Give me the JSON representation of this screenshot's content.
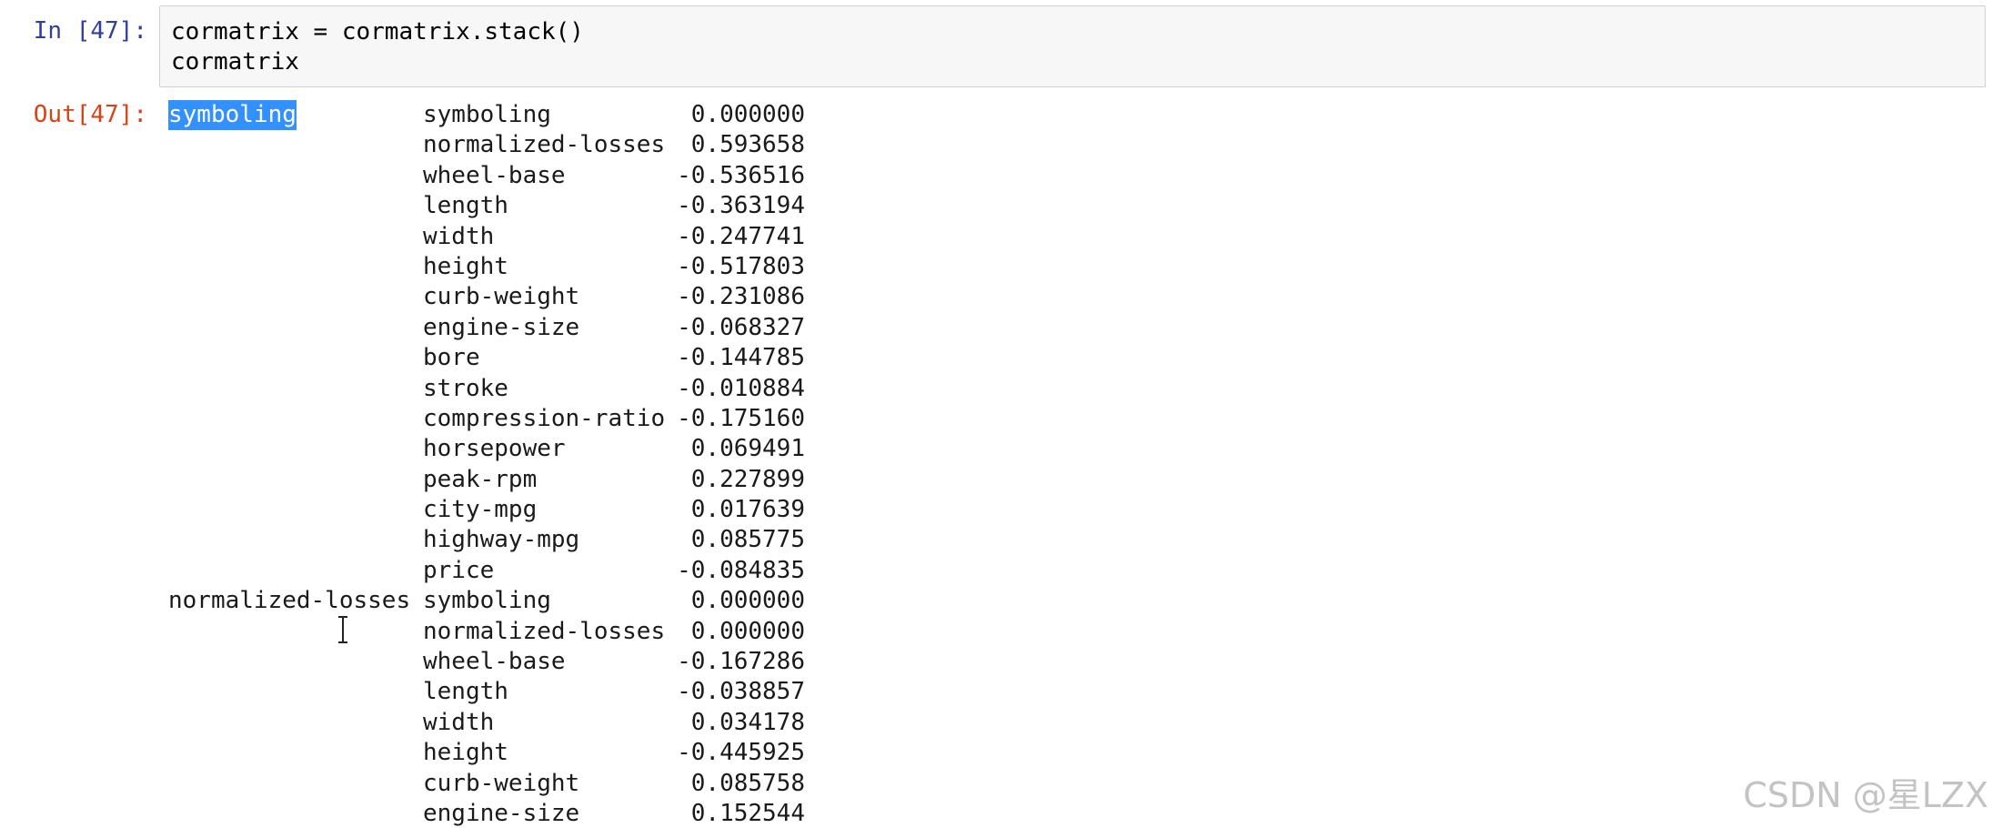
{
  "input_cell": {
    "prompt": "In [47]:",
    "code_lines": [
      "cormatrix = cormatrix.stack()",
      "cormatrix"
    ]
  },
  "output_cell": {
    "prompt": "Out[47]:",
    "rows": [
      {
        "level0": "symboling",
        "level1": "symboling",
        "value": "0.000000"
      },
      {
        "level0": "",
        "level1": "normalized-losses",
        "value": "0.593658"
      },
      {
        "level0": "",
        "level1": "wheel-base",
        "value": "-0.536516"
      },
      {
        "level0": "",
        "level1": "length",
        "value": "-0.363194"
      },
      {
        "level0": "",
        "level1": "width",
        "value": "-0.247741"
      },
      {
        "level0": "",
        "level1": "height",
        "value": "-0.517803"
      },
      {
        "level0": "",
        "level1": "curb-weight",
        "value": "-0.231086"
      },
      {
        "level0": "",
        "level1": "engine-size",
        "value": "-0.068327"
      },
      {
        "level0": "",
        "level1": "bore",
        "value": "-0.144785"
      },
      {
        "level0": "",
        "level1": "stroke",
        "value": "-0.010884"
      },
      {
        "level0": "",
        "level1": "compression-ratio",
        "value": "-0.175160"
      },
      {
        "level0": "",
        "level1": "horsepower",
        "value": "0.069491"
      },
      {
        "level0": "",
        "level1": "peak-rpm",
        "value": "0.227899"
      },
      {
        "level0": "",
        "level1": "city-mpg",
        "value": "0.017639"
      },
      {
        "level0": "",
        "level1": "highway-mpg",
        "value": "0.085775"
      },
      {
        "level0": "",
        "level1": "price",
        "value": "-0.084835"
      },
      {
        "level0": "normalized-losses",
        "level1": "symboling",
        "value": "0.000000"
      },
      {
        "level0": "",
        "level1": "normalized-losses",
        "value": "0.000000"
      },
      {
        "level0": "",
        "level1": "wheel-base",
        "value": "-0.167286"
      },
      {
        "level0": "",
        "level1": "length",
        "value": "-0.038857"
      },
      {
        "level0": "",
        "level1": "width",
        "value": "0.034178"
      },
      {
        "level0": "",
        "level1": "height",
        "value": "-0.445925"
      },
      {
        "level0": "",
        "level1": "curb-weight",
        "value": "0.085758"
      },
      {
        "level0": "",
        "level1": "engine-size",
        "value": "0.152544"
      }
    ],
    "selected_text": "symboling"
  },
  "cursor_icon": "text-cursor-icon",
  "watermark": "CSDN @星LZX",
  "colors": {
    "in_prompt": "#303f9f",
    "out_prompt": "#d84315",
    "selection": "#3390ff",
    "code_background": "#f7f7f7"
  }
}
